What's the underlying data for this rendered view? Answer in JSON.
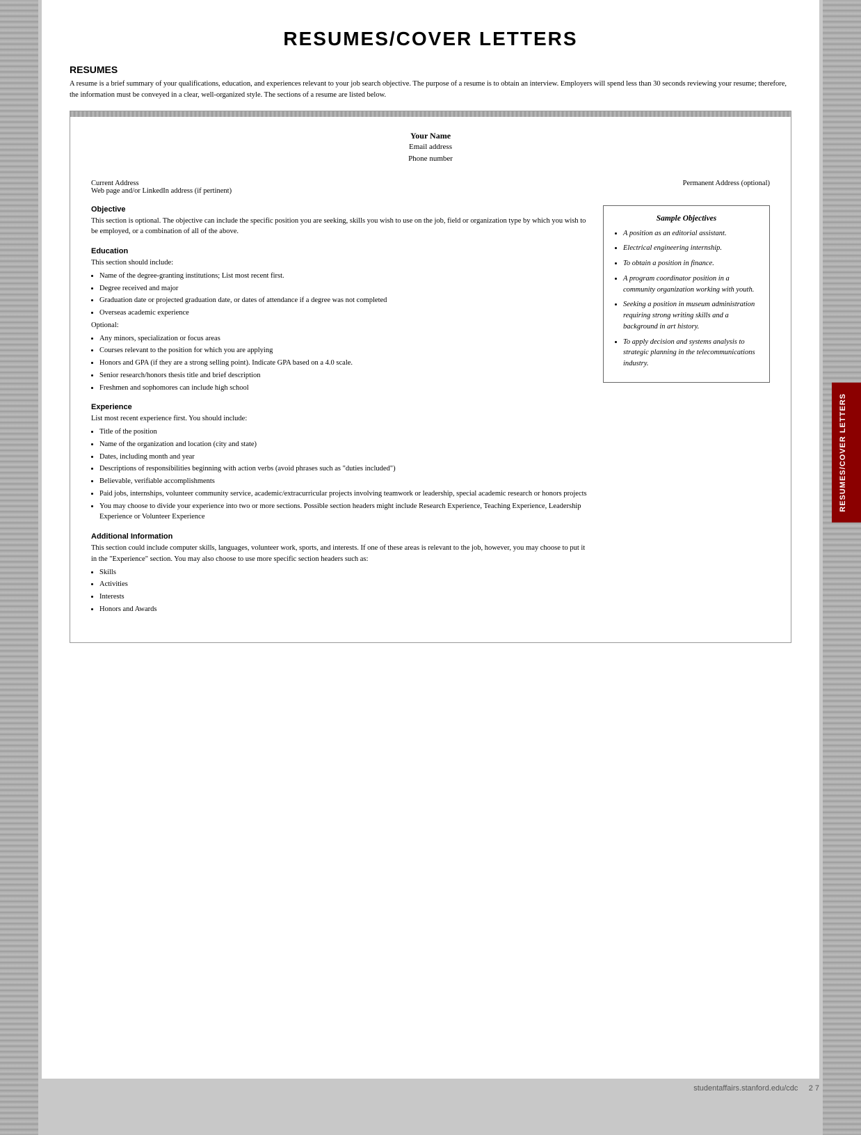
{
  "page": {
    "title": "RESUMES/COVER LETTERS",
    "footer": {
      "url": "studentaffairs.stanford.edu/cdc",
      "page_num": "2 7"
    }
  },
  "resumes_section": {
    "heading": "RESUMES",
    "intro": "A resume is a brief summary of your qualifications, education, and experiences relevant to your job search objective. The purpose of a resume is to obtain an interview. Employers will spend less than 30 seconds reviewing your resume; therefore, the information must be conveyed in a clear, well-organized style. The sections of a resume are listed below."
  },
  "resume_doc": {
    "name": "Your Name",
    "email": "Email address",
    "phone": "Phone number",
    "current_address_label": "Current Address",
    "web_address": "Web page and/or LinkedIn address (if pertinent)",
    "permanent_address_label": "Permanent Address (optional)",
    "objective_heading": "Objective",
    "objective_text": "This section is optional. The objective can include the specific position you are seeking, skills you wish to use on the job, field or organization type by which you wish to be employed, or a combination of all of the above.",
    "education_heading": "Education",
    "education_intro": "This section should include:",
    "education_items": [
      "Name of the degree-granting institutions; List most recent first.",
      "Degree received and major",
      "Graduation date or projected graduation date, or dates of attendance if a degree was not completed",
      "Overseas academic experience"
    ],
    "education_optional_label": "Optional:",
    "education_optional_items": [
      "Any minors, specialization or focus areas",
      "Courses relevant to the position for which you are applying",
      "Honors and GPA (if they are a strong selling point). Indicate GPA based on a 4.0 scale.",
      "Senior research/honors thesis title and brief description",
      "Freshmen and sophomores can include high school"
    ],
    "experience_heading": "Experience",
    "experience_intro": "List most recent experience first. You should include:",
    "experience_items": [
      "Title of the position",
      "Name of the organization and location (city and state)",
      "Dates, including month and year",
      "Descriptions of responsibilities beginning with action verbs (avoid phrases such as \"duties included\")",
      "Believable, verifiable accomplishments",
      "Paid jobs, internships, volunteer community service, academic/extracurricular projects involving teamwork or leadership, special academic research or honors projects",
      "You may choose to divide your experience into two or more sections. Possible section headers might include Research Experience, Teaching Experience, Leadership Experience or Volunteer Experience"
    ],
    "additional_heading": "Additional Information",
    "additional_intro": "This section could include computer skills, languages, volunteer work, sports, and interests. If one of these areas is relevant to the job, however, you may choose to put it in the \"Experience\" section. You may also choose to use more specific section headers such as:",
    "additional_items": [
      "Skills",
      "Activities",
      "Interests",
      "Honors and Awards"
    ]
  },
  "sample_objectives": {
    "title": "Sample Objectives",
    "items": [
      "A position as an editorial assistant.",
      "Electrical engineering internship.",
      "To obtain a position in finance.",
      "A program coordinator position in a community organization working with youth.",
      "Seeking a position in museum administration requiring strong writing skills and a background in art history.",
      "To apply decision and systems analysis to strategic planning in the telecommunications industry."
    ]
  },
  "side_tab": {
    "label": "RESUMES/COVER LETTERS"
  }
}
